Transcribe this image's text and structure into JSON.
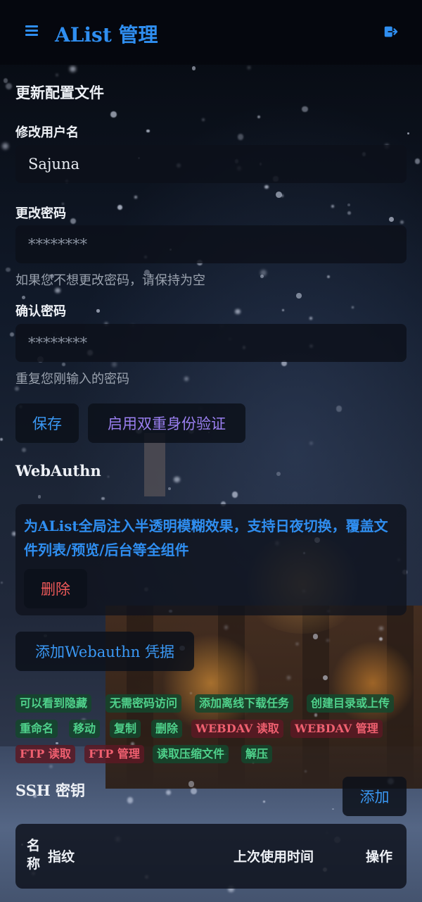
{
  "header": {
    "title": "AList 管理",
    "menu_icon": "hamburger-icon",
    "logout_icon": "logout-icon",
    "accent": "#2f8ef0"
  },
  "profile": {
    "section_title": "更新配置文件",
    "username_label": "修改用户名",
    "username_value": "Sajuna",
    "password_label": "更改密码",
    "password_placeholder": "********",
    "password_help": "如果您不想更改密码，请保持为空",
    "confirm_label": "确认密码",
    "confirm_placeholder": "********",
    "confirm_help": "重复您刚输入的密码",
    "save_label": "保存",
    "twofa_label": "启用双重身份验证"
  },
  "webauthn": {
    "section_title": "WebAuthn",
    "credential_name": "为AList全局注入半透明模糊效果，支持日夜切换，覆盖文件列表/预览/后台等全组件",
    "delete_label": "删除",
    "add_label": "添加Webauthn 凭据"
  },
  "permissions": [
    {
      "label": "可以看到隐藏",
      "status": "green"
    },
    {
      "label": "无需密码访问",
      "status": "green"
    },
    {
      "label": "添加离线下载任务",
      "status": "green"
    },
    {
      "label": "创建目录或上传",
      "status": "green"
    },
    {
      "label": "重命名",
      "status": "green"
    },
    {
      "label": "移动",
      "status": "green"
    },
    {
      "label": "复制",
      "status": "green"
    },
    {
      "label": "删除",
      "status": "green"
    },
    {
      "label": "WEBDAV 读取",
      "status": "red"
    },
    {
      "label": "WEBDAV 管理",
      "status": "red"
    },
    {
      "label": "FTP 读取",
      "status": "red"
    },
    {
      "label": "FTP 管理",
      "status": "red"
    },
    {
      "label": "读取压缩文件",
      "status": "green"
    },
    {
      "label": "解压",
      "status": "green"
    }
  ],
  "ssh": {
    "section_title": "SSH 密钥",
    "add_label": "添加",
    "columns": [
      "名称",
      "指纹",
      "上次使用时间",
      "操作"
    ]
  }
}
